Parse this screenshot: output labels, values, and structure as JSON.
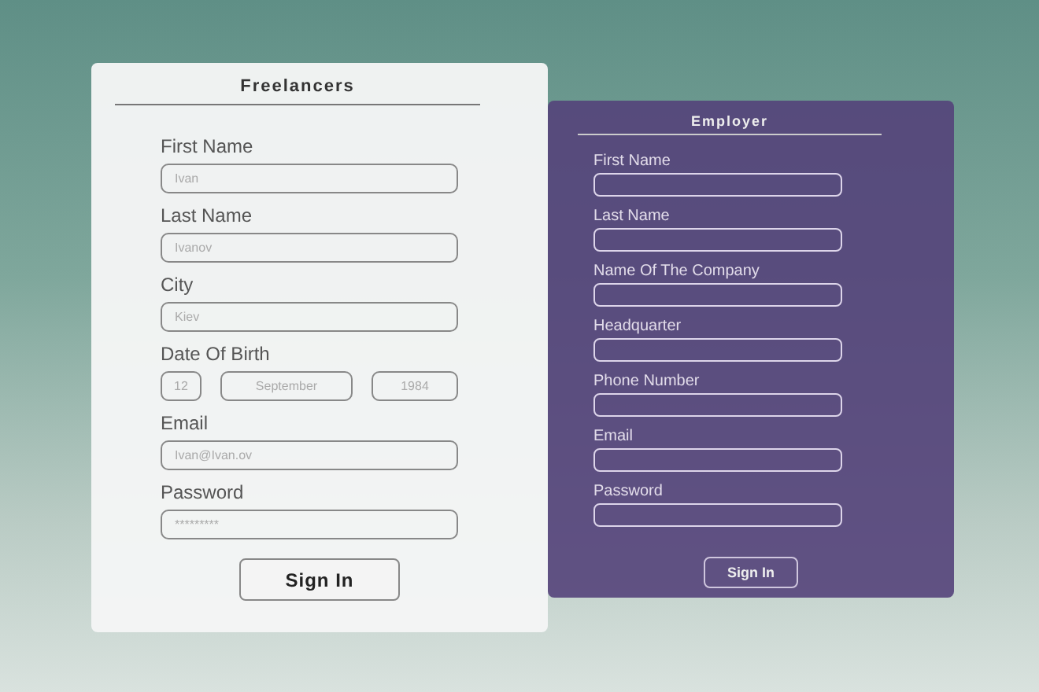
{
  "freelancers": {
    "title": "Freelancers",
    "fields": [
      {
        "kind": "text",
        "label": "First Name",
        "placeholder": "Ivan"
      },
      {
        "kind": "text",
        "label": "Last Name",
        "placeholder": "Ivanov"
      },
      {
        "kind": "text",
        "label": "City",
        "placeholder": "Kiev"
      },
      {
        "kind": "date",
        "label": "Date Of Birth",
        "parts": [
          {
            "placeholder": "12"
          },
          {
            "placeholder": "September"
          },
          {
            "placeholder": "1984"
          }
        ]
      },
      {
        "kind": "text",
        "label": "Email",
        "placeholder": "Ivan@Ivan.ov"
      },
      {
        "kind": "text",
        "label": "Password",
        "placeholder": "*********"
      }
    ],
    "button": "Sign In"
  },
  "employer": {
    "title": "Employer",
    "fields": [
      {
        "kind": "text",
        "label": "First Name"
      },
      {
        "kind": "text",
        "label": "Last Name"
      },
      {
        "kind": "text",
        "label": "Name Of The Company"
      },
      {
        "kind": "text",
        "label": "Headquarter"
      },
      {
        "kind": "text",
        "label": "Phone Number"
      },
      {
        "kind": "text",
        "label": "Email"
      },
      {
        "kind": "text",
        "label": "Password"
      }
    ],
    "button": "Sign In"
  }
}
